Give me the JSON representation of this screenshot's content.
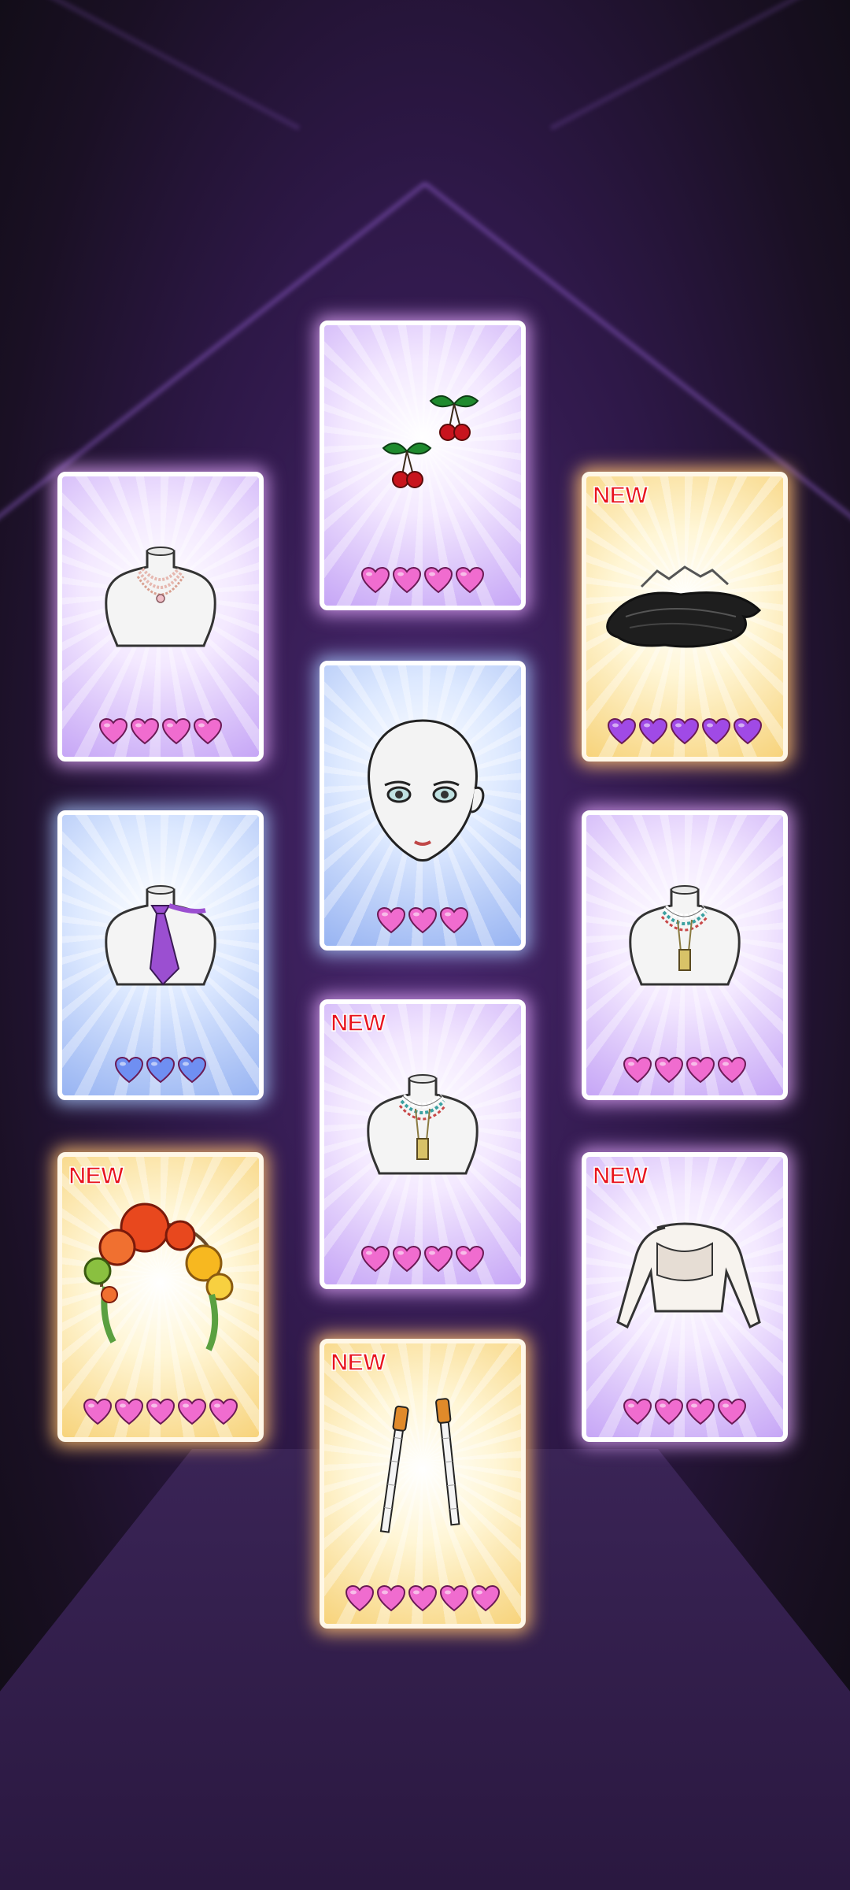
{
  "colors": {
    "heart_pink": "#f06ccf",
    "heart_blue": "#6f8ff2",
    "heart_purple": "#a04ae6",
    "new_red": "#e8141e"
  },
  "cards": [
    {
      "id": "cherry-earrings",
      "frame": "pink",
      "is_new": false,
      "new_label": "",
      "hearts": 4,
      "heart_color": "pink",
      "icon": "cherry-earrings-icon"
    },
    {
      "id": "pearl-necklace",
      "frame": "pink",
      "is_new": false,
      "new_label": "",
      "hearts": 4,
      "heart_color": "pink",
      "icon": "pearl-necklace-icon"
    },
    {
      "id": "dark-hair",
      "frame": "gold",
      "is_new": true,
      "new_label": "NEW",
      "hearts": 5,
      "heart_color": "purple",
      "icon": "dark-hair-icon"
    },
    {
      "id": "face",
      "frame": "blue",
      "is_new": false,
      "new_label": "",
      "hearts": 3,
      "heart_color": "pink",
      "icon": "face-icon"
    },
    {
      "id": "purple-tie",
      "frame": "blue",
      "is_new": false,
      "new_label": "",
      "hearts": 3,
      "heart_color": "blue",
      "icon": "purple-tie-icon"
    },
    {
      "id": "beaded-necklace-right",
      "frame": "pink",
      "is_new": false,
      "new_label": "",
      "hearts": 4,
      "heart_color": "pink",
      "icon": "beaded-necklace-icon"
    },
    {
      "id": "beaded-necklace-center",
      "frame": "pink",
      "is_new": true,
      "new_label": "NEW",
      "hearts": 4,
      "heart_color": "pink",
      "icon": "beaded-necklace-icon"
    },
    {
      "id": "flower-headpiece",
      "frame": "gold",
      "is_new": true,
      "new_label": "NEW",
      "hearts": 5,
      "heart_color": "pink",
      "icon": "flower-headpiece-icon"
    },
    {
      "id": "white-shrug",
      "frame": "pink",
      "is_new": true,
      "new_label": "NEW",
      "hearts": 4,
      "heart_color": "pink",
      "icon": "white-shrug-icon"
    },
    {
      "id": "hair-sticks",
      "frame": "gold",
      "is_new": true,
      "new_label": "NEW",
      "hearts": 5,
      "heart_color": "pink",
      "icon": "hair-sticks-icon"
    }
  ]
}
